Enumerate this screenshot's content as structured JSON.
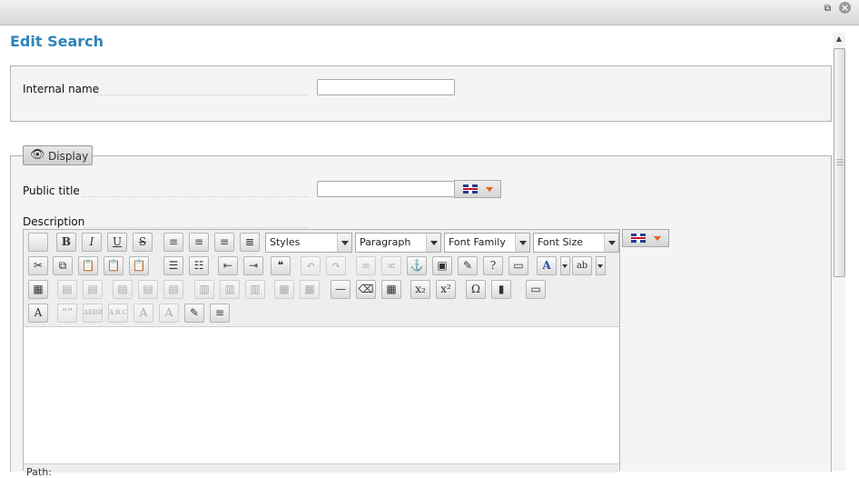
{
  "window": {
    "restore_glyph": "⧉",
    "close_glyph": "×"
  },
  "page": {
    "title": "Edit Search"
  },
  "general": {
    "internal_name_label": "Internal name",
    "internal_name_value": ""
  },
  "display": {
    "legend_label": "Display",
    "legend_icon": "eye-icon",
    "public_title_label": "Public title",
    "public_title_value": "",
    "description_label": "Description",
    "language_flag": "uk-flag-icon"
  },
  "editor": {
    "styles": "Styles",
    "format": "Paragraph",
    "font_family": "Font Family",
    "font_size": "Font Size",
    "path_label": "Path:",
    "row1": [
      {
        "name": "new-document-icon",
        "glyph": "",
        "disabled": false
      },
      {
        "name": "bold-button",
        "glyph": "B",
        "disabled": false
      },
      {
        "name": "italic-button",
        "glyph": "I",
        "disabled": false
      },
      {
        "name": "underline-button",
        "glyph": "U",
        "disabled": false
      },
      {
        "name": "strikethrough-button",
        "glyph": "S",
        "disabled": false
      },
      {
        "name": "align-left-button",
        "glyph": "≡",
        "disabled": false
      },
      {
        "name": "align-center-button",
        "glyph": "≡",
        "disabled": false
      },
      {
        "name": "align-right-button",
        "glyph": "≡",
        "disabled": false
      },
      {
        "name": "align-justify-button",
        "glyph": "≣",
        "disabled": false
      }
    ],
    "row2": [
      {
        "name": "cut-icon",
        "glyph": "✂",
        "disabled": false
      },
      {
        "name": "copy-icon",
        "glyph": "⧉",
        "disabled": false
      },
      {
        "name": "paste-icon",
        "glyph": "📋",
        "disabled": false
      },
      {
        "name": "paste-text-icon",
        "glyph": "📋",
        "disabled": false
      },
      {
        "name": "paste-word-icon",
        "glyph": "📋",
        "disabled": false
      },
      {
        "name": "bullet-list-icon",
        "glyph": "☰",
        "disabled": false
      },
      {
        "name": "numbered-list-icon",
        "glyph": "☷",
        "disabled": false
      },
      {
        "name": "outdent-icon",
        "glyph": "⇤",
        "disabled": false
      },
      {
        "name": "indent-icon",
        "glyph": "⇥",
        "disabled": false
      },
      {
        "name": "blockquote-icon",
        "glyph": "❝",
        "disabled": false
      },
      {
        "name": "undo-icon",
        "glyph": "↶",
        "disabled": true
      },
      {
        "name": "redo-icon",
        "glyph": "↷",
        "disabled": true
      },
      {
        "name": "link-icon",
        "glyph": "∞",
        "disabled": true
      },
      {
        "name": "unlink-icon",
        "glyph": "∞",
        "disabled": true
      },
      {
        "name": "anchor-icon",
        "glyph": "⚓",
        "disabled": false
      },
      {
        "name": "image-icon",
        "glyph": "▣",
        "disabled": false
      },
      {
        "name": "cleanup-icon",
        "glyph": "✎",
        "disabled": false
      },
      {
        "name": "help-icon",
        "glyph": "?",
        "disabled": false
      },
      {
        "name": "html-source-icon",
        "glyph": "▭",
        "disabled": false
      }
    ],
    "row3": [
      {
        "name": "table-insert-icon",
        "glyph": "▦",
        "disabled": false
      },
      {
        "name": "row-props-icon",
        "glyph": "▤",
        "disabled": true
      },
      {
        "name": "cell-props-icon",
        "glyph": "▤",
        "disabled": true
      },
      {
        "name": "row-before-icon",
        "glyph": "▤",
        "disabled": true
      },
      {
        "name": "row-after-icon",
        "glyph": "▤",
        "disabled": true
      },
      {
        "name": "delete-row-icon",
        "glyph": "▤",
        "disabled": true
      },
      {
        "name": "col-before-icon",
        "glyph": "▥",
        "disabled": true
      },
      {
        "name": "col-after-icon",
        "glyph": "▥",
        "disabled": true
      },
      {
        "name": "delete-col-icon",
        "glyph": "▥",
        "disabled": true
      },
      {
        "name": "split-cells-icon",
        "glyph": "▦",
        "disabled": true
      },
      {
        "name": "merge-cells-icon",
        "glyph": "▦",
        "disabled": true
      },
      {
        "name": "horizontal-rule-icon",
        "glyph": "—",
        "disabled": false
      },
      {
        "name": "remove-format-icon",
        "glyph": "⌫",
        "disabled": false
      },
      {
        "name": "visual-aid-icon",
        "glyph": "▦",
        "disabled": false
      },
      {
        "name": "subscript-icon",
        "glyph": "x₂",
        "disabled": false
      },
      {
        "name": "superscript-icon",
        "glyph": "x²",
        "disabled": false
      },
      {
        "name": "special-char-icon",
        "glyph": "Ω",
        "disabled": false
      },
      {
        "name": "media-icon",
        "glyph": "▮",
        "disabled": false
      },
      {
        "name": "template-icon",
        "glyph": "▭",
        "disabled": false
      }
    ],
    "row4": [
      {
        "name": "styleprops-icon",
        "glyph": "A",
        "disabled": false
      },
      {
        "name": "cite-icon",
        "glyph": "“”",
        "disabled": true
      },
      {
        "name": "abbr-icon",
        "glyph": "ABBR",
        "disabled": true
      },
      {
        "name": "acronym-icon",
        "glyph": "A.B.C",
        "disabled": true
      },
      {
        "name": "delete-text-icon",
        "glyph": "A",
        "disabled": true
      },
      {
        "name": "insert-text-icon",
        "glyph": "A",
        "disabled": true
      },
      {
        "name": "attribs-icon",
        "glyph": "✎",
        "disabled": false
      },
      {
        "name": "visualchars-icon",
        "glyph": "≡",
        "disabled": false
      }
    ]
  },
  "colors": {
    "accent": "#2e84b8",
    "panel_bg": "#f4f4f4",
    "border": "#b3b3b3",
    "flag_caret": "#e85d1e"
  }
}
